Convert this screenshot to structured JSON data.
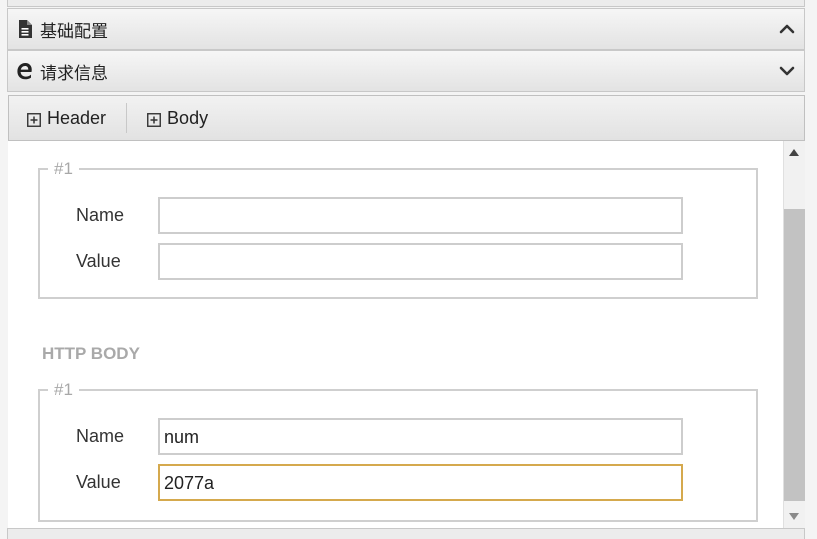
{
  "panels": {
    "basic_config": {
      "title": "基础配置",
      "icon": "document-icon",
      "state_icon": "chevron-up-icon"
    },
    "request_info": {
      "title": "请求信息",
      "icon": "edge-e-icon",
      "state_icon": "chevron-down-icon"
    }
  },
  "toolbar": {
    "header_label": "Header",
    "body_label": "Body",
    "icon": "plus-box-icon"
  },
  "header_section": {
    "entries": [
      {
        "legend": "#1",
        "name_label": "Name",
        "name_value": "",
        "value_label": "Value",
        "value_value": ""
      }
    ]
  },
  "body_section": {
    "title": "HTTP BODY",
    "entries": [
      {
        "legend": "#1",
        "name_label": "Name",
        "name_value": "num",
        "value_label": "Value",
        "value_value": "2077a"
      }
    ]
  },
  "colors": {
    "focus_border": "#d5a94d",
    "field_border": "#cdcdcd",
    "muted_text": "#a9a9a9"
  }
}
